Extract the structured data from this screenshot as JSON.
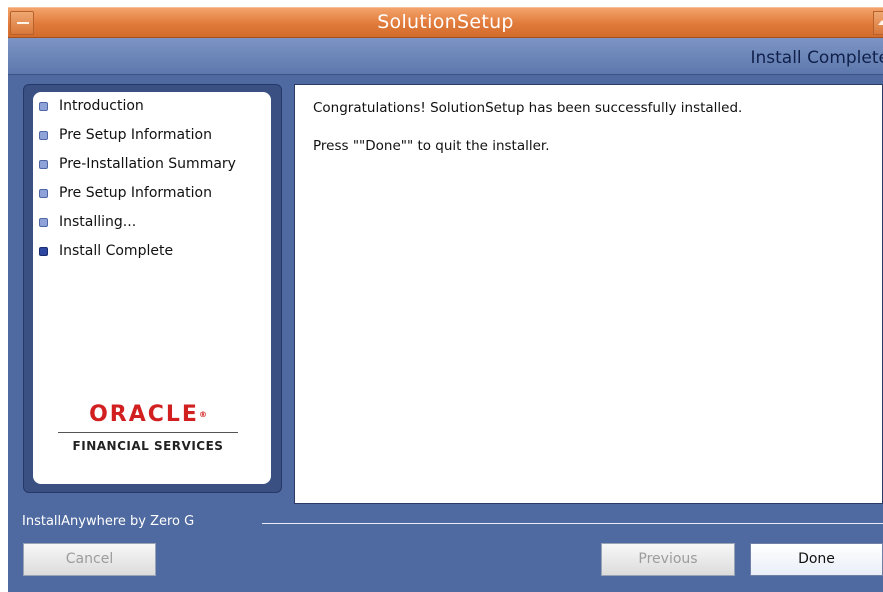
{
  "window": {
    "title": "SolutionSetup"
  },
  "header": {
    "step_title": "Install Complete"
  },
  "steps": {
    "items": [
      {
        "label": "Introduction",
        "state": "done"
      },
      {
        "label": "Pre Setup Information",
        "state": "done"
      },
      {
        "label": "Pre-Installation Summary",
        "state": "done"
      },
      {
        "label": "Pre Setup Information",
        "state": "done"
      },
      {
        "label": "Installing...",
        "state": "done"
      },
      {
        "label": "Install Complete",
        "state": "current"
      }
    ]
  },
  "logo": {
    "brand": "ORACLE",
    "trademark": "®",
    "subtitle": "FINANCIAL SERVICES"
  },
  "content": {
    "message_1": "Congratulations! SolutionSetup has been successfully installed.",
    "message_2": "Press \"\"Done\"\" to quit the installer."
  },
  "footer": {
    "brand_text": "InstallAnywhere by Zero G",
    "cancel_label": "Cancel",
    "previous_label": "Previous",
    "done_label": "Done"
  },
  "colors": {
    "title_bar": "#e07a3a",
    "panel_blue": "#4f6aa0",
    "oracle_red": "#d21f1f"
  }
}
